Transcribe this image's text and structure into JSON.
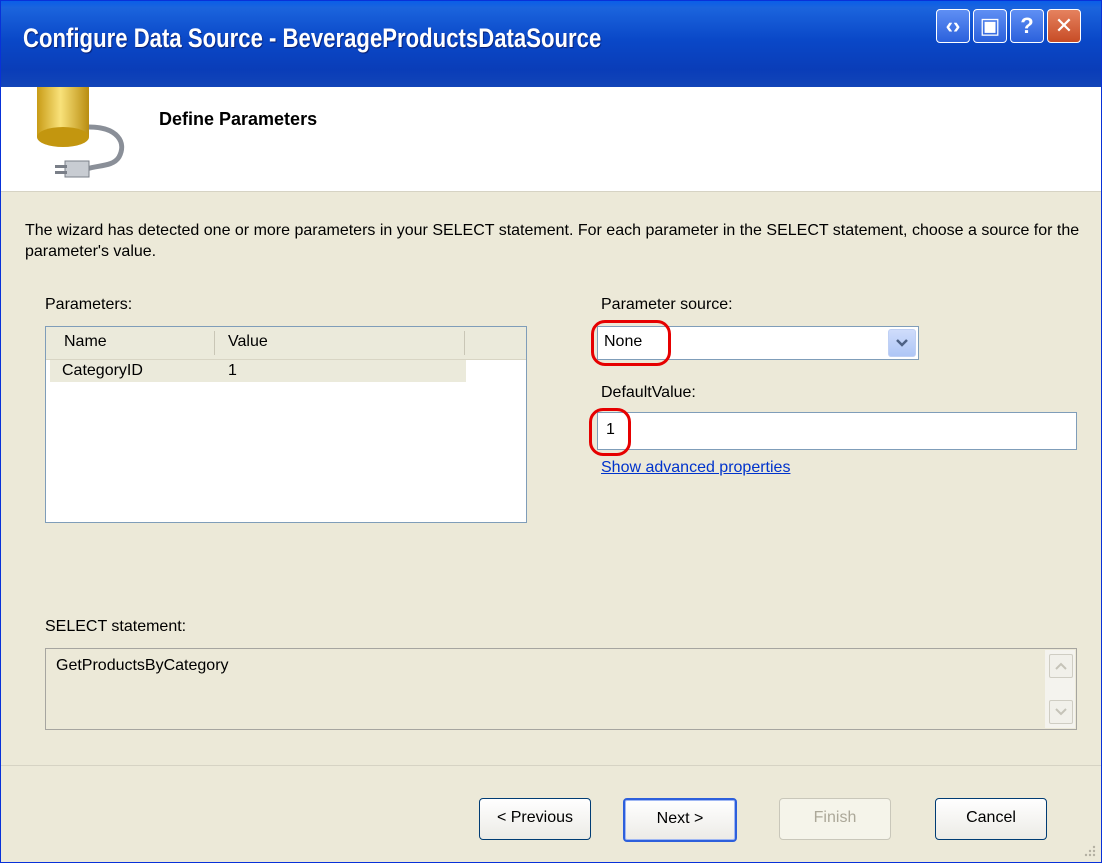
{
  "window": {
    "title": "Configure Data Source - BeverageProductsDataSource"
  },
  "header": {
    "title": "Define Parameters"
  },
  "description": "The wizard has detected one or more parameters in your SELECT statement. For each parameter in the SELECT statement, choose a source for the parameter's value.",
  "parameters": {
    "label": "Parameters:",
    "columns": [
      "Name",
      "Value"
    ],
    "rows": [
      {
        "name": "CategoryID",
        "value": "1"
      }
    ]
  },
  "parameter_source": {
    "label": "Parameter source:",
    "selected": "None"
  },
  "default_value": {
    "label": "DefaultValue:",
    "value": "1"
  },
  "advanced_link": "Show advanced properties",
  "select_statement": {
    "label": "SELECT statement:",
    "value": "GetProductsByCategory"
  },
  "buttons": {
    "previous": "< Previous",
    "next": "Next >",
    "finish": "Finish",
    "cancel": "Cancel"
  },
  "colors": {
    "titlebar": "#0a48c8",
    "highlight": "#e60000",
    "link": "#0033cc"
  }
}
